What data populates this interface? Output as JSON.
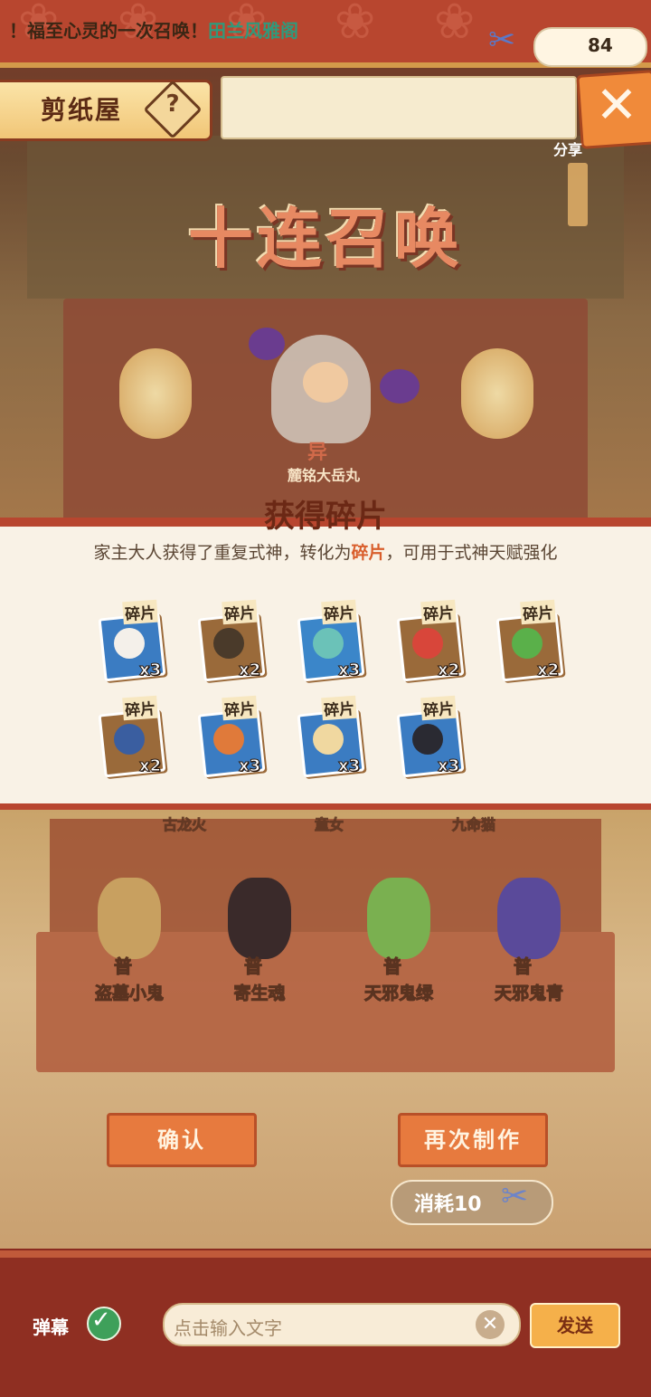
{
  "header": {
    "title": "剪纸屋",
    "help_icon": "?",
    "marquee_prefix": "！福至心灵的一次召唤！",
    "marquee_name": "田兰风雅阁",
    "close_icon": "✕",
    "share_label": "分享"
  },
  "currency": {
    "icon": "paper-doll-icon",
    "value": "84"
  },
  "summon": {
    "title": "十连召唤",
    "featured_rank": "异",
    "featured_name": "麓铭大岳丸"
  },
  "fragments": {
    "title": "获得碎片",
    "desc_prefix": "家主大人获得了重复式神，转化为",
    "desc_highlight": "碎片",
    "desc_suffix": "，可用于式神天赋强化",
    "tag": "碎片",
    "items": [
      {
        "count": "x3",
        "color": "#3b7cc2",
        "face": "#f4f0ea"
      },
      {
        "count": "x2",
        "color": "#9a6a3a",
        "face": "#4a3a2a"
      },
      {
        "count": "x3",
        "color": "#3b86c9",
        "face": "#6bc2b8"
      },
      {
        "count": "x2",
        "color": "#9a6a3a",
        "face": "#d8463a"
      },
      {
        "count": "x2",
        "color": "#9a6a3a",
        "face": "#5ab04a"
      },
      {
        "count": "x2",
        "color": "#9a6a3a",
        "face": "#3a5ea0"
      },
      {
        "count": "x3",
        "color": "#3b7cc2",
        "face": "#e07a3a"
      },
      {
        "count": "x3",
        "color": "#3b7cc2",
        "face": "#f0d8a0"
      },
      {
        "count": "x3",
        "color": "#3b7cc2",
        "face": "#2a2a32"
      }
    ]
  },
  "shikigami": {
    "faded_names": [
      "古龙火",
      "童女",
      "九命猫"
    ],
    "items": [
      {
        "rank": "普",
        "name": "盗墓小鬼",
        "color": "#c8a060"
      },
      {
        "rank": "普",
        "name": "寄生魂",
        "color": "#3a2a2a"
      },
      {
        "rank": "普",
        "name": "天邪鬼绿",
        "color": "#7ab050"
      },
      {
        "rank": "普",
        "name": "天邪鬼青",
        "color": "#5a4a9a"
      }
    ]
  },
  "actions": {
    "confirm_label": "确认",
    "again_label": "再次制作",
    "cost_label": "消耗10"
  },
  "chat": {
    "danmaku_label": "弹幕",
    "input_placeholder": "点击输入文字",
    "clear_icon": "✕",
    "send_label": "发送"
  }
}
